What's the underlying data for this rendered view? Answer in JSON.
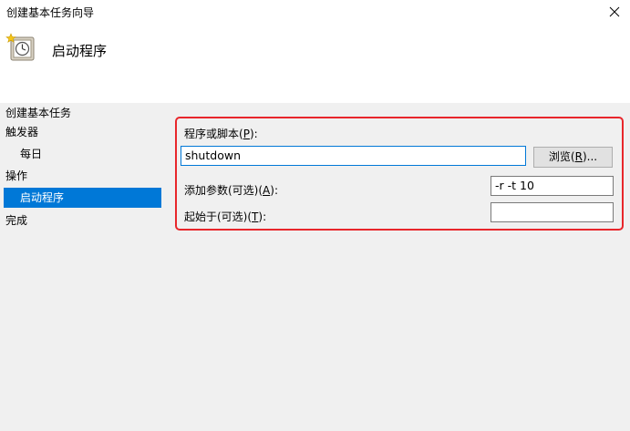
{
  "window": {
    "title": "创建基本任务向导"
  },
  "header": {
    "heading": "启动程序"
  },
  "sidebar": {
    "items": [
      {
        "label": "创建基本任务"
      },
      {
        "label": "触发器"
      },
      {
        "label": "每日"
      },
      {
        "label": "操作"
      },
      {
        "label": "启动程序"
      },
      {
        "label": "完成"
      }
    ],
    "selected": "启动程序"
  },
  "form": {
    "program_label_text": "程序或脚本(",
    "program_label_key": "P",
    "program_label_tail": "):",
    "program_value": "shutdown",
    "browse_text": "浏览(",
    "browse_key": "R",
    "browse_tail": ")...",
    "args_label_text": "添加参数(可选)(",
    "args_label_key": "A",
    "args_label_tail": "):",
    "args_value": "-r -t 10",
    "start_label_text": "起始于(可选)(",
    "start_label_key": "T",
    "start_label_tail": "):",
    "start_value": ""
  },
  "colors": {
    "selection": "#0078d7",
    "highlight_border": "#e8262b"
  },
  "icons": {
    "close": "close-icon",
    "task": "task-clock-icon"
  }
}
